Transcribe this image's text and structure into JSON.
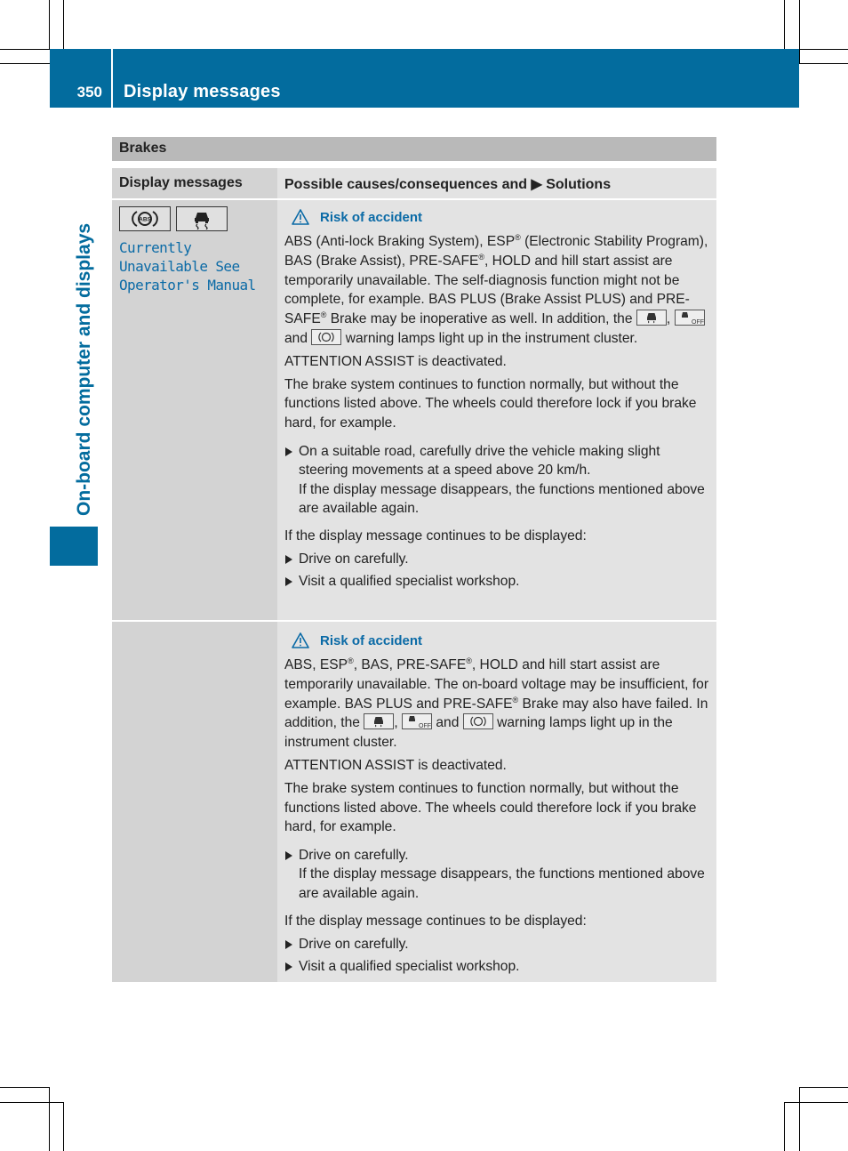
{
  "header": {
    "page_number": "350",
    "title": "Display messages"
  },
  "side_tab": {
    "title": "On-board computer and displays"
  },
  "section": {
    "title": "Brakes"
  },
  "table": {
    "columns": [
      "Display messages",
      "Possible causes/consequences and ▶ Solutions"
    ],
    "rows": [
      {
        "display_icons": [
          "abs-warning-icon",
          "esp-skid-icon"
        ],
        "display_message": "Currently\nUnavailable See\nOperator's Manual",
        "warning_title": "Risk of accident",
        "p1_a": "ABS (Anti-lock Braking System), ESP",
        "p1_b": " (Electronic Stability Program), BAS (Brake Assist), PRE-SAFE",
        "p1_c": ", HOLD and hill start assist are temporarily unavailable. The self-diagnosis function might not be complete, for example. BAS PLUS (Brake Assist PLUS) and PRE-SAFE",
        "p1_d": " Brake may be inoperative as well. In addition, the",
        "p1_sep1": ",",
        "p1_and": "and",
        "p1_e": "warning lamps light up in the instrument cluster.",
        "registered": "®",
        "p2": "ATTENTION ASSIST is deactivated.",
        "p3": "The brake system continues to function normally, but without the functions listed above. The wheels could therefore lock if you brake hard, for example.",
        "bullet1_line1": "On a suitable road, carefully drive the vehicle making slight steering movements at a speed above 20 km/h.",
        "bullet1_line2": "If the display message disappears, the functions mentioned above are available again.",
        "p4": "If the display message continues to be displayed:",
        "bullet2": "Drive on carefully.",
        "bullet3": "Visit a qualified specialist workshop."
      },
      {
        "display_icons": [],
        "display_message": "",
        "warning_title": "Risk of accident",
        "p1_a": "ABS, ESP",
        "p1_b": ", BAS, PRE-SAFE",
        "p1_c": ", HOLD and hill start assist are temporarily unavailable. The on-board voltage may be insufficient, for example. BAS PLUS and PRE-SAFE",
        "p1_d": " Brake may also have failed. In addition, the",
        "p1_sep1": ",",
        "p1_and": "and",
        "p1_e": "warning lamps light up in the instrument cluster.",
        "registered": "®",
        "p2": "ATTENTION ASSIST is deactivated.",
        "p3": "The brake system continues to function normally, but without the functions listed above. The wheels could therefore lock if you brake hard, for example.",
        "bullet1_line1": "Drive on carefully.",
        "bullet1_line2": "If the display message disappears, the functions mentioned above are available again.",
        "p4": "If the display message continues to be displayed:",
        "bullet2": "Drive on carefully.",
        "bullet3": "Visit a qualified specialist workshop."
      }
    ]
  },
  "colors": {
    "brand_blue": "#036c9e",
    "message_blue": "#0a6aa6",
    "section_gray": "#b9b9b9"
  }
}
